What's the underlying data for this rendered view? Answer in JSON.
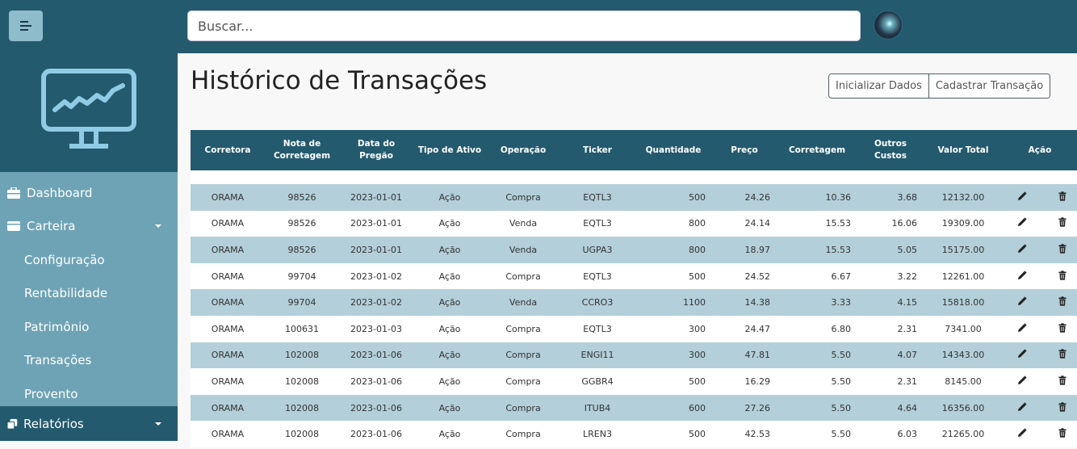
{
  "search": {
    "placeholder": "Buscar..."
  },
  "sidebar": {
    "items": [
      {
        "label": "Dashboard",
        "icon": "briefcase-icon"
      },
      {
        "label": "Carteira",
        "icon": "wallet-icon",
        "expanded": true
      },
      {
        "label": "Configuração"
      },
      {
        "label": "Rentabilidade"
      },
      {
        "label": "Patrimônio"
      },
      {
        "label": "Transações"
      },
      {
        "label": "Provento"
      }
    ],
    "bottom": {
      "label": "Relatórios",
      "icon": "copy-icon"
    }
  },
  "page": {
    "title": "Histórico de Transações"
  },
  "buttons": {
    "init": "Inicializar Dados",
    "register": "Cadastrar Transação"
  },
  "table": {
    "headers": [
      "Corretora",
      "Nota de Corretagem",
      "Data do Pregão",
      "Tipo de Ativo",
      "Operação",
      "Ticker",
      "Quantidade",
      "Preço",
      "Corretagem",
      "Outros Custos",
      "Valor Total",
      "Ação"
    ],
    "rows": [
      [
        "ORAMA",
        "98526",
        "2023-01-01",
        "Ação",
        "Compra",
        "EQTL3",
        "500",
        "24.26",
        "10.36",
        "3.68",
        "12132.00"
      ],
      [
        "ORAMA",
        "98526",
        "2023-01-01",
        "Ação",
        "Venda",
        "EQTL3",
        "800",
        "24.14",
        "15.53",
        "16.06",
        "19309.00"
      ],
      [
        "ORAMA",
        "98526",
        "2023-01-01",
        "Ação",
        "Venda",
        "UGPA3",
        "800",
        "18.97",
        "15.53",
        "5.05",
        "15175.00"
      ],
      [
        "ORAMA",
        "99704",
        "2023-01-02",
        "Ação",
        "Compra",
        "EQTL3",
        "500",
        "24.52",
        "6.67",
        "3.22",
        "12261.00"
      ],
      [
        "ORAMA",
        "99704",
        "2023-01-02",
        "Ação",
        "Venda",
        "CCRO3",
        "1100",
        "14.38",
        "3.33",
        "4.15",
        "15818.00"
      ],
      [
        "ORAMA",
        "100631",
        "2023-01-03",
        "Ação",
        "Compra",
        "EQTL3",
        "300",
        "24.47",
        "6.80",
        "2.31",
        "7341.00"
      ],
      [
        "ORAMA",
        "102008",
        "2023-01-06",
        "Ação",
        "Compra",
        "ENGI11",
        "300",
        "47.81",
        "5.50",
        "4.07",
        "14343.00"
      ],
      [
        "ORAMA",
        "102008",
        "2023-01-06",
        "Ação",
        "Compra",
        "GGBR4",
        "500",
        "16.29",
        "5.50",
        "2.31",
        "8145.00"
      ],
      [
        "ORAMA",
        "102008",
        "2023-01-06",
        "Ação",
        "Compra",
        "ITUB4",
        "600",
        "27.26",
        "5.50",
        "4.64",
        "16356.00"
      ],
      [
        "ORAMA",
        "102008",
        "2023-01-06",
        "Ação",
        "Compra",
        "LREN3",
        "500",
        "42.53",
        "5.50",
        "6.03",
        "21265.00"
      ]
    ]
  },
  "colors": {
    "topbar": "#245a6e",
    "sidebar": "#6ea3b5",
    "row_alt": "#b3cfd9"
  }
}
